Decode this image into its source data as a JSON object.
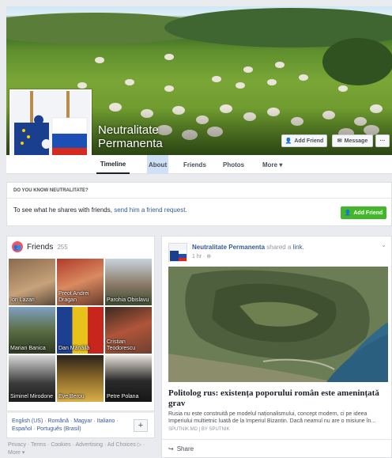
{
  "page": {
    "name_line1": "Neutralitate",
    "name_line2": "Permanenta",
    "add_friend_label": "Add Friend",
    "message_label": "Message",
    "more_dots": "···"
  },
  "nav": {
    "tabs": [
      "Timeline",
      "About",
      "Friends",
      "Photos",
      "More ▾"
    ]
  },
  "know_box": {
    "heading": "DO YOU KNOW NEUTRALITATE?",
    "text": "To see what he shares with friends, ",
    "link_text": "send him a friend request.",
    "button_label": "Add Friend"
  },
  "friends": {
    "title": "Friends",
    "count": "255",
    "items": [
      {
        "name": "Ion Lazari"
      },
      {
        "name": "Preot Andrei Dragan"
      },
      {
        "name": "Parohia Obislavu"
      },
      {
        "name": "Marian Banica"
      },
      {
        "name": "Dan Mănăilă"
      },
      {
        "name": "Cristian Teodorescu"
      },
      {
        "name": "Siminel Mirodone"
      },
      {
        "name": "Eve Berou"
      },
      {
        "name": "Petre Polana"
      }
    ]
  },
  "languages": {
    "line1": "English (US) · Română · Magyar · Italiano ·",
    "line2": "Español · Português (Brasil)",
    "plus": "+"
  },
  "footer": {
    "line1": "Privacy · Terms · Cookies · Advertising · Ad Choices ▷ ·",
    "line2": "More ▾"
  },
  "post": {
    "author": "Neutralitate Permanenta",
    "shared_text": " shared a ",
    "link_word": "link.",
    "meta": "1 hr · ⊕",
    "title": "Politolog rus: existența poporului român este amenințată grav",
    "description": "Rusia nu este construită pe modelul naționalismului, concept modern, ci pe ideea Imperiului multietnic luată de la Imperiul Bizantin. Dacă neamul nu are o misiune în...",
    "source": "SPUTNIK.MD | BY SPUTNIK",
    "share_label": "Share"
  },
  "colors": {
    "accent": "#365899",
    "green": "#42b72a",
    "friends_icon": "#f35369"
  }
}
